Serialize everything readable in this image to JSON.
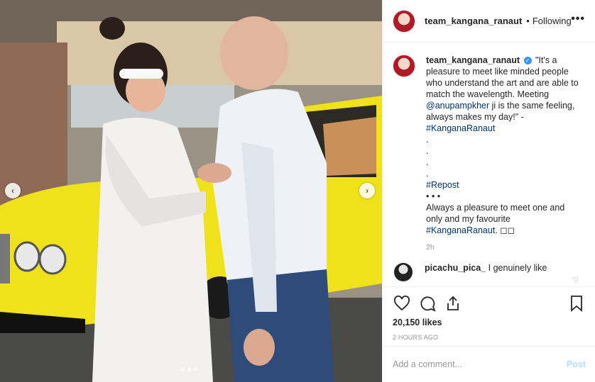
{
  "header": {
    "username": "team_kangana_ranaut",
    "separator": "•",
    "follow_status": "Following",
    "more": "•••"
  },
  "media": {
    "prev": "‹",
    "next": "›",
    "dots": 3,
    "active_dot": 2
  },
  "caption": {
    "username": "team_kangana_ranaut",
    "quote": "\"It's a pleasure to meet like minded people who understand the art and are able to match the wavelength. Meeting",
    "mention": "@anupampkher",
    "after_mention": "ji is the same feeling, always makes my day!\" -",
    "hashtag1": "#KanganaRanaut",
    "dots": [
      ".",
      ".",
      ".",
      "."
    ],
    "hashtag2": "#Repost",
    "ellipsis": "• • •",
    "text2": "Always a pleasure to meet one and only and my favourite",
    "hashtag3": "#KanganaRanaut",
    "tail": ". ◻◻",
    "time": "2h"
  },
  "comment": {
    "username": "picachu_pica_",
    "text": "I genuinely like"
  },
  "actions": {
    "likes": "20,150 likes",
    "time_ago": "2 HOURS AGO"
  },
  "add_comment": {
    "placeholder": "Add a comment...",
    "post": "Post"
  },
  "colors": {
    "accent": "#3897f0",
    "link": "#003569",
    "post_disabled": "#b2dffc"
  }
}
